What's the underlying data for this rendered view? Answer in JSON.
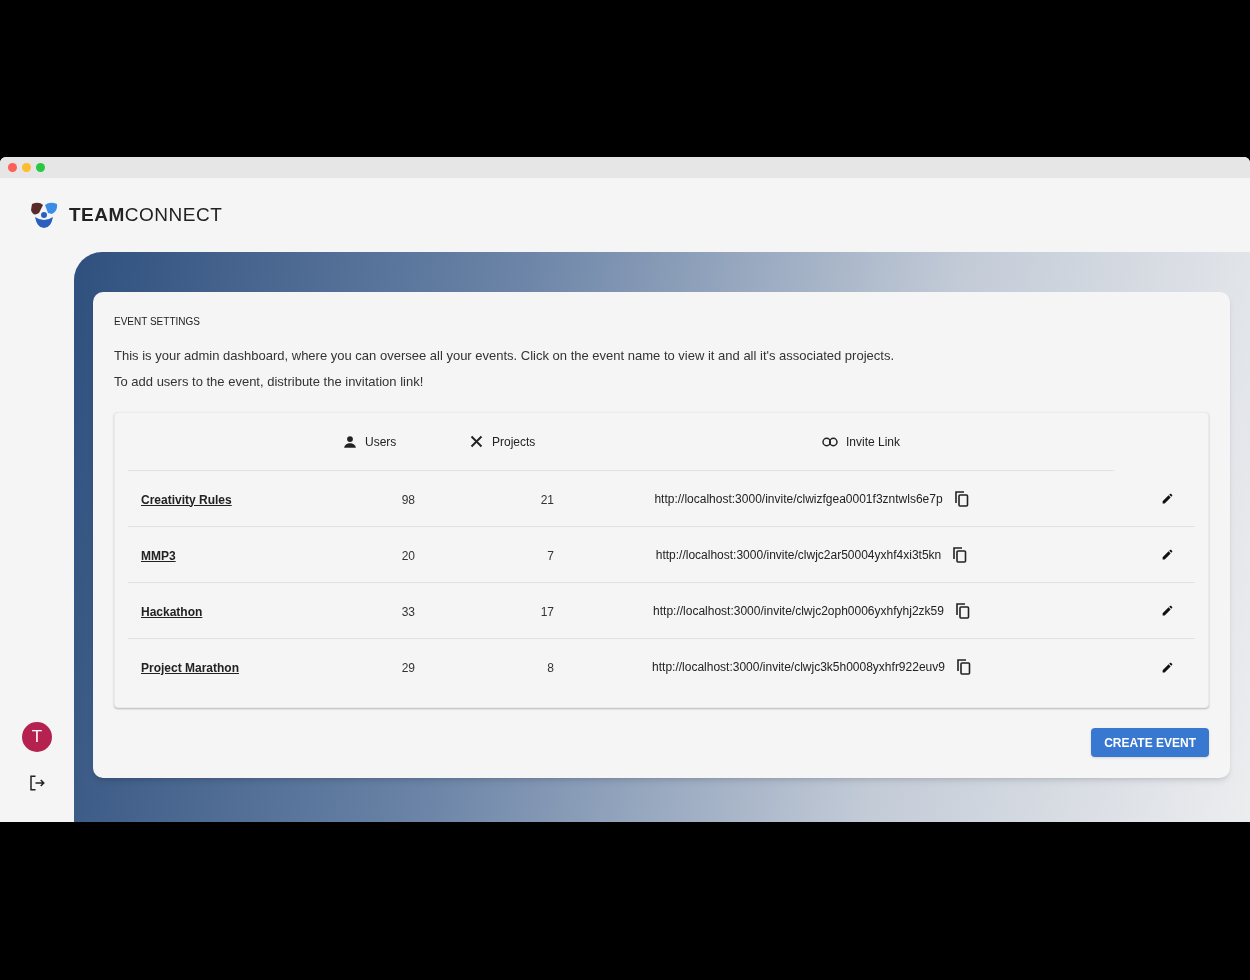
{
  "app": {
    "logo_text": "**TEAM**CONNECT"
  },
  "card": {
    "title": "EVENT SETTINGS",
    "paragraphs": [
      "This is your admin dashboard, where you can oversee all your events. Click on the event name to view it and all it's associated projects.",
      "To add users to the event, distribute the invitation link!"
    ]
  },
  "table": {
    "columns": [
      {
        "label": "Users",
        "kind": "users"
      },
      {
        "label": "Projects",
        "kind": "projects"
      },
      {
        "label": "Invite Link",
        "kind": "link"
      }
    ],
    "rows": [
      {
        "name": "Creativity Rules",
        "users": "98",
        "projects": "21",
        "link": "http://localhost:3000/invite/clwizfgea0001f3zntwls6e7p"
      },
      {
        "name": "MMP3",
        "users": "20",
        "projects": "7",
        "link": "http://localhost:3000/invite/clwjc2ar50004yxhf4xi3t5kn"
      },
      {
        "name": "Hackathon",
        "users": "33",
        "projects": "17",
        "link": "http://localhost:3000/invite/clwjc2oph0006yxhfyhj2zk59"
      },
      {
        "name": "Project Marathon",
        "users": "29",
        "projects": "8",
        "link": "http://localhost:3000/invite/clwjc3k5h0008yxhfr922euv9"
      }
    ]
  },
  "create_button": "CREATE EVENT",
  "sidebar": {
    "avatar_initial": "T"
  }
}
